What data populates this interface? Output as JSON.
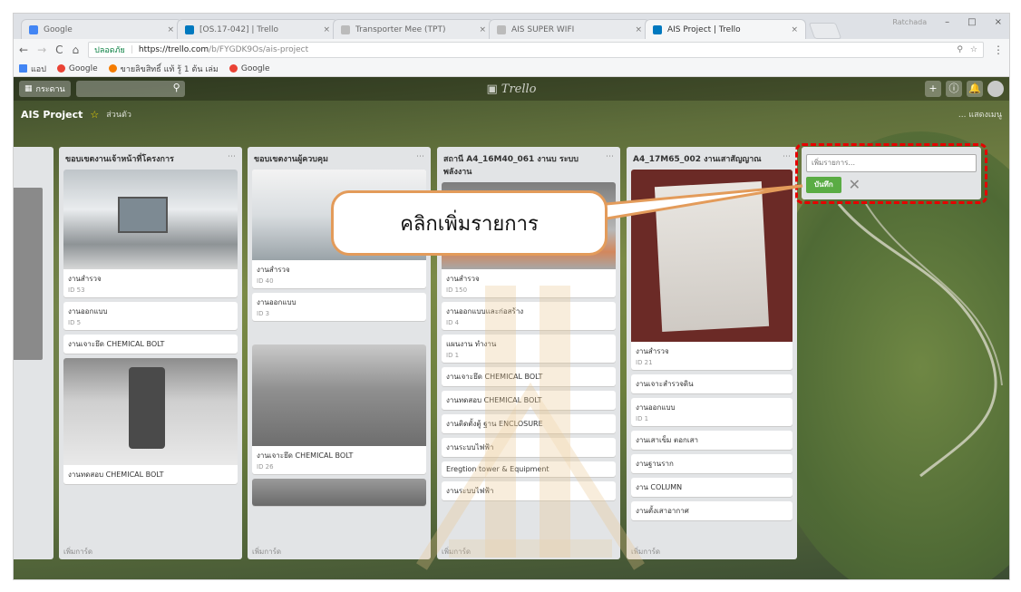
{
  "browser": {
    "tabs": [
      {
        "title": "Google",
        "favicon_color": "#4285f4",
        "active": false
      },
      {
        "title": "[OS.17-042] | Trello",
        "favicon_color": "#0079bf",
        "active": false
      },
      {
        "title": "Transporter Mee (TPT)",
        "favicon_color": "#bbbbbb",
        "active": false
      },
      {
        "title": "AIS SUPER WIFI",
        "favicon_color": "#bbbbbb",
        "active": false
      },
      {
        "title": "AIS Project | Trello",
        "favicon_color": "#0079bf",
        "active": true
      }
    ],
    "tab_close_glyph": "×",
    "window_user": "Ratchada",
    "window_controls": [
      "–",
      "□",
      "×"
    ],
    "nav": {
      "back": "←",
      "forward": "→",
      "reload": "C",
      "home": "⌂"
    },
    "url_secure_label": "ปลอดภัย",
    "url_host": "https://trello.com",
    "url_path": "/b/FYGDK9Os/ais-project",
    "omni_icons": [
      "⚲",
      "☆"
    ],
    "menu_glyph": "⋮",
    "bookmarks": [
      {
        "label": "แอป",
        "icon_color": "#4285f4"
      },
      {
        "label": "Google",
        "icon_color": "#ea4335"
      },
      {
        "label": "ขายลิขสิทธิ์ แท้ รู้ 1 ต้น เล่ม",
        "icon_color": "#f57c00"
      },
      {
        "label": "Google",
        "icon_color": "#ea4335"
      }
    ]
  },
  "trello": {
    "boards_button": "กระดาน",
    "logo": "Trello",
    "header_icons": [
      "+",
      "ⓘ",
      "🔔"
    ],
    "board_title": "AIS Project",
    "board_star": "☆",
    "board_visibility": "ส่วนตัว",
    "board_menu": "... แสดงเมนู",
    "lists": [
      {
        "title": "ขอบเขตงานเจ้าหน้าที่โครงการ",
        "cards": [
          {
            "title": "งานสำรวจ",
            "meta": "ID 53"
          },
          {
            "title": "งานออกแบบ",
            "meta": "ID 5"
          },
          {
            "title": "งานเจาะยึด CHEMICAL BOLT",
            "meta": ""
          },
          {
            "title": "งานทดสอบ CHEMICAL BOLT",
            "meta": ""
          }
        ],
        "add_card": "เพิ่มการ์ด"
      },
      {
        "title": "ขอบเขตงานผู้ควบคุม",
        "cards": [
          {
            "title": "งานสำรวจ",
            "meta": "ID 40"
          },
          {
            "title": "งานออกแบบ",
            "meta": "ID 3"
          },
          {
            "title": "งานเจาะยึด CHEMICAL BOLT",
            "meta": "ID 26"
          }
        ],
        "add_card": "เพิ่มการ์ด"
      },
      {
        "title": "สถานี A4_16M40_061 งานบ ระบบพลังงาน",
        "cards": [
          {
            "title": "งานสำรวจ",
            "meta": "ID 150"
          },
          {
            "title": "งานออกแบบและก่อสร้าง",
            "meta": "ID 4"
          },
          {
            "title": "แผนงาน ทำงาน",
            "meta": "ID 1"
          },
          {
            "title": "งานเจาะยึด CHEMICAL BOLT",
            "meta": ""
          },
          {
            "title": "งานทดสอบ CHEMICAL BOLT",
            "meta": ""
          },
          {
            "title": "งานติดตั้งตู้ ฐาน ENCLOSURE",
            "meta": ""
          },
          {
            "title": "งานระบบไฟฟ้า",
            "meta": ""
          },
          {
            "title": "Eregtion tower & Equipment",
            "meta": ""
          },
          {
            "title": "งานระบบไฟฟ้า",
            "meta": ""
          }
        ],
        "add_card": "เพิ่มการ์ด"
      },
      {
        "title": "A4_17M65_002 งานเสาสัญญาณ",
        "cards": [
          {
            "title": "งานสำรวจ",
            "meta": "ID 21"
          },
          {
            "title": "งานเจาะสำรวจดิน",
            "meta": ""
          },
          {
            "title": "งานออกแบบ",
            "meta": "ID 1"
          },
          {
            "title": "งานเสาเข็ม ตอกเสา",
            "meta": ""
          },
          {
            "title": "งานฐานราก",
            "meta": ""
          },
          {
            "title": "งาน COLUMN",
            "meta": ""
          },
          {
            "title": "งานตั้งเสาอากาศ",
            "meta": ""
          }
        ],
        "add_card": "เพิ่มการ์ด"
      }
    ],
    "add_list": {
      "placeholder": "เพิ่มรายการ...",
      "save_label": "บันทึก",
      "cancel_glyph": "✕"
    }
  },
  "annotation": {
    "callout_text": "คลิกเพิ่มรายการ",
    "highlight_color": "#e60000",
    "callout_border_color": "#e39b5a"
  },
  "colors": {
    "trello_green": "#5aac44",
    "list_bg": "#e2e4e6",
    "star": "#f2d600"
  }
}
